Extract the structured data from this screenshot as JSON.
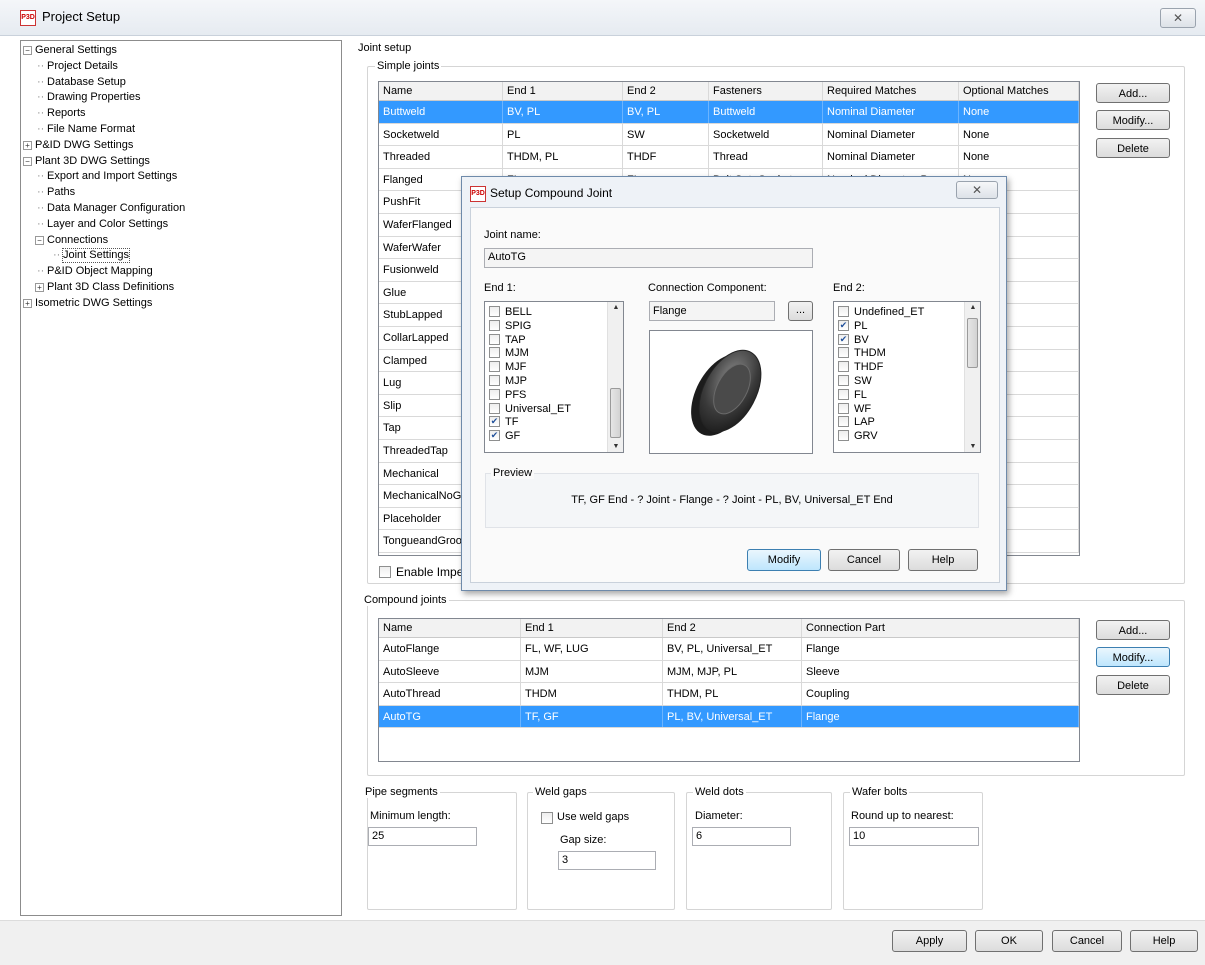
{
  "window": {
    "title": "Project Setup",
    "close": "✕"
  },
  "tree": [
    {
      "label": "General Settings",
      "level": 0,
      "toggle": "-"
    },
    {
      "label": "Project Details",
      "level": 1
    },
    {
      "label": "Database Setup",
      "level": 1
    },
    {
      "label": "Drawing Properties",
      "level": 1
    },
    {
      "label": "Reports",
      "level": 1
    },
    {
      "label": "File Name Format",
      "level": 1
    },
    {
      "label": "P&ID DWG Settings",
      "level": 0,
      "toggle": "+"
    },
    {
      "label": "Plant 3D DWG Settings",
      "level": 0,
      "toggle": "-"
    },
    {
      "label": "Export and Import Settings",
      "level": 1
    },
    {
      "label": "Paths",
      "level": 1
    },
    {
      "label": "Data Manager Configuration",
      "level": 1
    },
    {
      "label": "Layer and Color Settings",
      "level": 1
    },
    {
      "label": "Connections",
      "level": 1,
      "toggle": "-"
    },
    {
      "label": "Joint Settings",
      "level": 2,
      "selected": true
    },
    {
      "label": "P&ID Object Mapping",
      "level": 1
    },
    {
      "label": "Plant 3D Class Definitions",
      "level": 1,
      "toggle": "+"
    },
    {
      "label": "Isometric DWG Settings",
      "level": 0,
      "toggle": "+"
    }
  ],
  "joint_setup": {
    "title": "Joint setup",
    "simple": {
      "title": "Simple joints",
      "columns": [
        "Name",
        "End 1",
        "End 2",
        "Fasteners",
        "Required Matches",
        "Optional Matches"
      ],
      "rows": [
        [
          "Buttweld",
          "BV, PL",
          "BV, PL",
          "Buttweld",
          "Nominal Diameter",
          "None"
        ],
        [
          "Socketweld",
          "PL",
          "SW",
          "Socketweld",
          "Nominal Diameter",
          "None"
        ],
        [
          "Threaded",
          "THDM, PL",
          "THDF",
          "Thread",
          "Nominal Diameter",
          "None"
        ],
        [
          "Flanged",
          "FL",
          "FL",
          "Bolt Set, Gasket",
          "Nominal Diameter, Pressu",
          "None"
        ],
        [
          "PushFit",
          "",
          "",
          "",
          "",
          ""
        ],
        [
          "WaferFlanged",
          "",
          "",
          "",
          "",
          ""
        ],
        [
          "WaferWafer",
          "",
          "",
          "",
          "",
          ""
        ],
        [
          "Fusionweld",
          "",
          "",
          "",
          "",
          ""
        ],
        [
          "Glue",
          "",
          "",
          "",
          "",
          ""
        ],
        [
          "StubLapped",
          "",
          "",
          "",
          "",
          ""
        ],
        [
          "CollarLapped",
          "",
          "",
          "",
          "",
          ""
        ],
        [
          "Clamped",
          "",
          "",
          "",
          "",
          ""
        ],
        [
          "Lug",
          "",
          "",
          "",
          "",
          ""
        ],
        [
          "Slip",
          "",
          "",
          "",
          "",
          ""
        ],
        [
          "Tap",
          "",
          "",
          "",
          "",
          ""
        ],
        [
          "ThreadedTap",
          "",
          "",
          "",
          "",
          ""
        ],
        [
          "Mechanical",
          "",
          "",
          "",
          "",
          ""
        ],
        [
          "MechanicalNoGl",
          "",
          "",
          "",
          "",
          ""
        ],
        [
          "Placeholder",
          "",
          "",
          "",
          "",
          ""
        ],
        [
          "TongueandGroo",
          "",
          "",
          "",
          "",
          ""
        ]
      ],
      "selected_row": 0,
      "buttons": {
        "add": "Add...",
        "modify": "Modify...",
        "delete": "Delete"
      },
      "enable_label": "Enable Imper"
    },
    "compound": {
      "title": "Compound joints",
      "columns": [
        "Name",
        "End 1",
        "End 2",
        "Connection Part"
      ],
      "rows": [
        [
          "AutoFlange",
          "FL, WF, LUG",
          "BV, PL, Universal_ET",
          "Flange"
        ],
        [
          "AutoSleeve",
          "MJM",
          "MJM, MJP, PL",
          "Sleeve"
        ],
        [
          "AutoThread",
          "THDM",
          "THDM, PL",
          "Coupling"
        ],
        [
          "AutoTG",
          "TF, GF",
          "PL, BV, Universal_ET",
          "Flange"
        ]
      ],
      "selected_row": 3,
      "buttons": {
        "add": "Add...",
        "modify": "Modify...",
        "delete": "Delete"
      }
    },
    "pipe_segments": {
      "title": "Pipe segments",
      "label": "Minimum length:",
      "value": "25"
    },
    "weld_gaps": {
      "title": "Weld gaps",
      "checkbox": "Use weld gaps",
      "label": "Gap size:",
      "value": "3"
    },
    "weld_dots": {
      "title": "Weld dots",
      "label": "Diameter:",
      "value": "6"
    },
    "wafer_bolts": {
      "title": "Wafer bolts",
      "label": "Round up to nearest:",
      "value": "10"
    }
  },
  "footer": {
    "apply": "Apply",
    "ok": "OK",
    "cancel": "Cancel",
    "help": "Help"
  },
  "dialog": {
    "title": "Setup Compound Joint",
    "close": "✕",
    "joint_name_label": "Joint name:",
    "joint_name": "AutoTG",
    "end1_label": "End 1:",
    "end1_items": [
      {
        "label": "BELL",
        "checked": false
      },
      {
        "label": "SPIG",
        "checked": false
      },
      {
        "label": "TAP",
        "checked": false
      },
      {
        "label": "MJM",
        "checked": false
      },
      {
        "label": "MJF",
        "checked": false
      },
      {
        "label": "MJP",
        "checked": false
      },
      {
        "label": "PFS",
        "checked": false
      },
      {
        "label": "Universal_ET",
        "checked": false
      },
      {
        "label": "TF",
        "checked": true
      },
      {
        "label": "GF",
        "checked": true
      }
    ],
    "connection_label": "Connection Component:",
    "connection_value": "Flange",
    "browse": "...",
    "end2_label": "End 2:",
    "end2_items": [
      {
        "label": "Undefined_ET",
        "checked": false
      },
      {
        "label": "PL",
        "checked": true
      },
      {
        "label": "BV",
        "checked": true
      },
      {
        "label": "THDM",
        "checked": false
      },
      {
        "label": "THDF",
        "checked": false
      },
      {
        "label": "SW",
        "checked": false
      },
      {
        "label": "FL",
        "checked": false
      },
      {
        "label": "WF",
        "checked": false
      },
      {
        "label": "LAP",
        "checked": false
      },
      {
        "label": "GRV",
        "checked": false
      }
    ],
    "preview_label": "Preview",
    "preview_text": "TF, GF End - ? Joint - Flange - ? Joint - PL, BV, Universal_ET End",
    "buttons": {
      "modify": "Modify",
      "cancel": "Cancel",
      "help": "Help"
    }
  },
  "colors": {
    "selection": "#3399ff",
    "title_bar": "#e6ebf1"
  },
  "icons": {
    "app": "plant-3d-app-icon",
    "check": "✔"
  }
}
